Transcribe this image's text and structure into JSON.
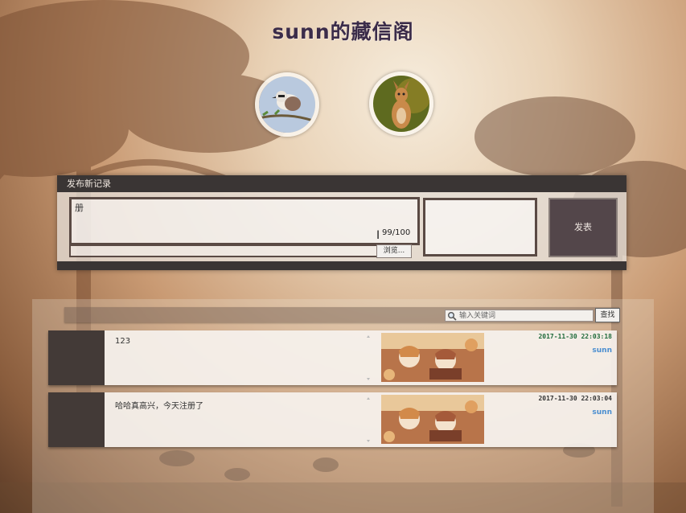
{
  "header": {
    "title": "sunn的藏信阁"
  },
  "publish": {
    "header_label": "发布新记录",
    "textarea_value": "册",
    "char_count": "99/100",
    "browse_label": "浏览...",
    "submit_label": "发表"
  },
  "search": {
    "placeholder": "输入关键词",
    "button_label": "查找"
  },
  "records": [
    {
      "text": "123",
      "date": "2017-11-30  22:03:18",
      "user": "sunn"
    },
    {
      "text": "哈哈真高兴，今天注册了",
      "date": "2017-11-30  22:03:04",
      "user": "sunn"
    }
  ],
  "colors": {
    "panel_dark": "#3a3534",
    "submit_bg": "#53464a",
    "date_green": "#1e6a3a",
    "user_blue": "#4a8ed0"
  }
}
